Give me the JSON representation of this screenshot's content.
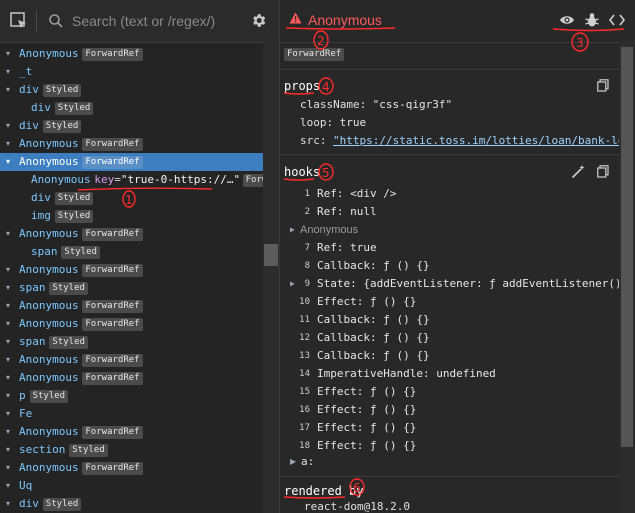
{
  "toolbar": {
    "search_placeholder": "Search (text or /regex/)"
  },
  "tree": [
    {
      "indent": 0,
      "arrow": "▾",
      "name": "Anonymous",
      "badge": "ForwardRef"
    },
    {
      "indent": 0,
      "arrow": "▾",
      "name": "_t",
      "badge": ""
    },
    {
      "indent": 0,
      "arrow": "▾",
      "name": "div",
      "badge": "Styled"
    },
    {
      "indent": 1,
      "arrow": "",
      "name": "div",
      "badge": "Styled"
    },
    {
      "indent": 0,
      "arrow": "▾",
      "name": "div",
      "badge": "Styled"
    },
    {
      "indent": 0,
      "arrow": "▾",
      "name": "Anonymous",
      "badge": "ForwardRef"
    },
    {
      "indent": 0,
      "arrow": "▾",
      "name": "Anonymous",
      "badge": "ForwardRef",
      "selected": true
    },
    {
      "indent": 1,
      "arrow": "",
      "name": "Anonymous",
      "badge": "ForwardRef",
      "key": "true-0-https://…"
    },
    {
      "indent": 1,
      "arrow": "",
      "name": "div",
      "badge": "Styled"
    },
    {
      "indent": 1,
      "arrow": "",
      "name": "img",
      "badge": "Styled"
    },
    {
      "indent": 0,
      "arrow": "▾",
      "name": "Anonymous",
      "badge": "ForwardRef"
    },
    {
      "indent": 1,
      "arrow": "",
      "name": "span",
      "badge": "Styled"
    },
    {
      "indent": 0,
      "arrow": "▾",
      "name": "Anonymous",
      "badge": "ForwardRef"
    },
    {
      "indent": 0,
      "arrow": "▾",
      "name": "span",
      "badge": "Styled"
    },
    {
      "indent": 0,
      "arrow": "▾",
      "name": "Anonymous",
      "badge": "ForwardRef"
    },
    {
      "indent": 0,
      "arrow": "▾",
      "name": "Anonymous",
      "badge": "ForwardRef"
    },
    {
      "indent": 0,
      "arrow": "▾",
      "name": "span",
      "badge": "Styled"
    },
    {
      "indent": 0,
      "arrow": "▾",
      "name": "Anonymous",
      "badge": "ForwardRef"
    },
    {
      "indent": 0,
      "arrow": "▾",
      "name": "Anonymous",
      "badge": "ForwardRef"
    },
    {
      "indent": 0,
      "arrow": "▾",
      "name": "p",
      "badge": "Styled"
    },
    {
      "indent": 0,
      "arrow": "▾",
      "name": "Fe",
      "badge": ""
    },
    {
      "indent": 0,
      "arrow": "▾",
      "name": "Anonymous",
      "badge": "ForwardRef"
    },
    {
      "indent": 0,
      "arrow": "▾",
      "name": "section",
      "badge": "Styled"
    },
    {
      "indent": 0,
      "arrow": "▾",
      "name": "Anonymous",
      "badge": "ForwardRef"
    },
    {
      "indent": 0,
      "arrow": "▾",
      "name": "Uq",
      "badge": ""
    },
    {
      "indent": 0,
      "arrow": "▾",
      "name": "div",
      "badge": "Styled"
    }
  ],
  "inspector": {
    "title": "Anonymous",
    "badge": "ForwardRef",
    "props_title": "props",
    "props": [
      {
        "key": "className:",
        "value": "\"css-qigr3f\"",
        "link": false
      },
      {
        "key": "loop:",
        "value": "true",
        "link": false
      },
      {
        "key": "src:",
        "value": "\"https://static.toss.im/lotties/loan/bank-loo…",
        "link": true
      }
    ],
    "hooks_title": "hooks",
    "hooks": [
      {
        "idx": "1",
        "text": "Ref: <div />",
        "expand": false,
        "sub": false
      },
      {
        "idx": "2",
        "text": "Ref: null",
        "expand": false,
        "sub": false
      },
      {
        "idx": "",
        "text": "Anonymous",
        "expand": true,
        "sub": true
      },
      {
        "idx": "7",
        "text": "Ref: true",
        "expand": false,
        "sub": false
      },
      {
        "idx": "8",
        "text": "Callback: ƒ () {}",
        "expand": false,
        "sub": false
      },
      {
        "idx": "9",
        "text": "State: {addEventListener: ƒ addEventListener() …",
        "expand": true,
        "sub": false
      },
      {
        "idx": "10",
        "text": "Effect: ƒ () {}",
        "expand": false,
        "sub": false
      },
      {
        "idx": "11",
        "text": "Callback: ƒ () {}",
        "expand": false,
        "sub": false
      },
      {
        "idx": "12",
        "text": "Callback: ƒ () {}",
        "expand": false,
        "sub": false
      },
      {
        "idx": "13",
        "text": "Callback: ƒ () {}",
        "expand": false,
        "sub": false
      },
      {
        "idx": "14",
        "text": "ImperativeHandle: undefined",
        "expand": false,
        "sub": false
      },
      {
        "idx": "15",
        "text": "Effect: ƒ () {}",
        "expand": false,
        "sub": false
      },
      {
        "idx": "16",
        "text": "Effect: ƒ () {}",
        "expand": false,
        "sub": false
      },
      {
        "idx": "17",
        "text": "Effect: ƒ () {}",
        "expand": false,
        "sub": false
      },
      {
        "idx": "18",
        "text": "Effect: ƒ () {}",
        "expand": false,
        "sub": false
      }
    ],
    "extra_key": "a:",
    "rendered_by_title": "rendered by",
    "rendered_by_value": "react-dom@18.2.0"
  },
  "annotations": [
    "1",
    "2",
    "3",
    "4",
    "5",
    "6"
  ],
  "colors": {
    "accent": "#3d7ec0",
    "warning": "#ff5a5a",
    "annotation": "#ff2a2a"
  }
}
